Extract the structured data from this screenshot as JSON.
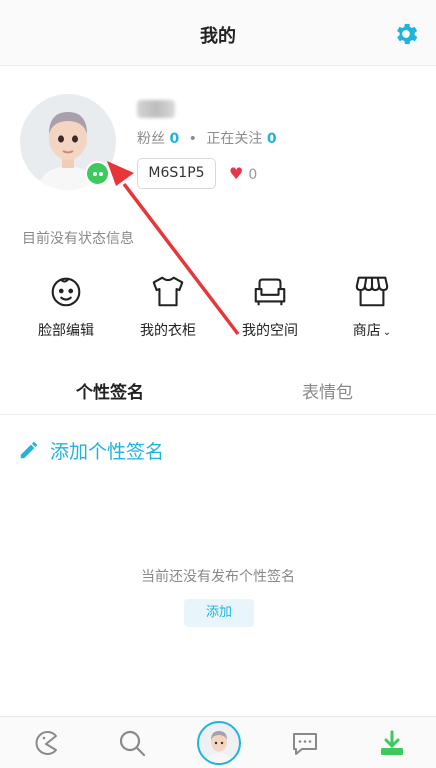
{
  "header": {
    "title": "我的",
    "settings_icon": "gear-icon"
  },
  "profile": {
    "fans_label": "粉丝",
    "fans_count": "0",
    "separator": "•",
    "following_label": "正在关注",
    "following_count": "0",
    "user_id": "M6S1P5",
    "likes_count": "0",
    "likes_icon": "heart-icon",
    "status_text": "目前没有状态信息"
  },
  "quick_actions": [
    {
      "label": "脸部编辑",
      "icon": "face-icon"
    },
    {
      "label": "我的衣柜",
      "icon": "shirt-icon"
    },
    {
      "label": "我的空间",
      "icon": "sofa-icon"
    },
    {
      "label": "商店",
      "icon": "store-icon"
    }
  ],
  "tabs": [
    {
      "label": "个性签名",
      "active": true
    },
    {
      "label": "表情包",
      "active": false
    }
  ],
  "signature": {
    "add_label": "添加个性签名",
    "empty_text": "当前还没有发布个性签名",
    "add_button": "添加"
  },
  "bottom_nav": [
    {
      "name": "home",
      "icon": "pacman-icon"
    },
    {
      "name": "search",
      "icon": "search-icon"
    },
    {
      "name": "profile",
      "icon": "avatar-icon"
    },
    {
      "name": "chat",
      "icon": "chat-icon"
    },
    {
      "name": "download",
      "icon": "download-icon"
    }
  ],
  "colors": {
    "accent": "#1fb3dd",
    "badge_green": "#3dc95e",
    "heart": "#e8344c",
    "annotation_arrow": "#e8353a"
  }
}
